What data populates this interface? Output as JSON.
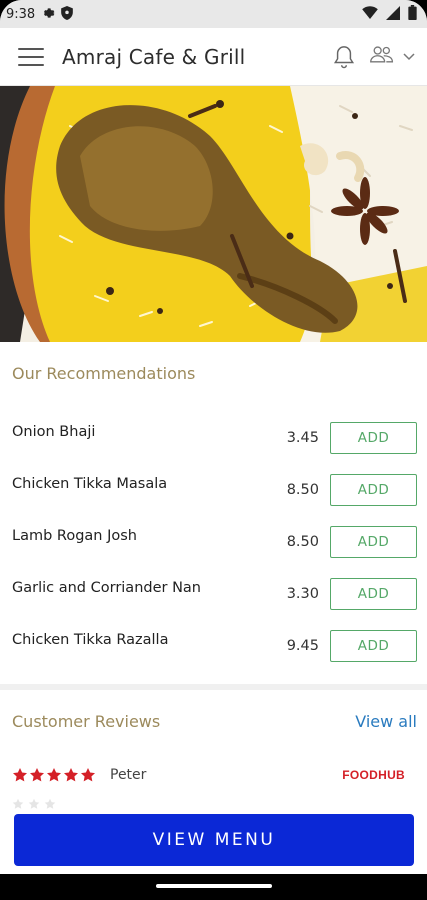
{
  "status_bar": {
    "time": "9:38",
    "icons": [
      "gear-icon",
      "shield-icon",
      "wifi-icon",
      "signal-icon",
      "battery-icon"
    ]
  },
  "app_bar": {
    "title": "Amraj Cafe & Grill",
    "icons": [
      "menu-icon",
      "bell-icon",
      "people-icon",
      "chevron-down-icon"
    ]
  },
  "hero": {
    "icon": "food-image"
  },
  "recommendations": {
    "title": "Our Recommendations",
    "items": [
      {
        "name": "Onion Bhaji",
        "price": "3.45",
        "button": "ADD"
      },
      {
        "name": "Chicken Tikka Masala",
        "price": "8.50",
        "button": "ADD"
      },
      {
        "name": "Lamb Rogan Josh",
        "price": "8.50",
        "button": "ADD"
      },
      {
        "name": "Garlic and Corriander Nan",
        "price": "3.30",
        "button": "ADD"
      },
      {
        "name": "Chicken Tikka Razalla",
        "price": "9.45",
        "button": "ADD"
      }
    ]
  },
  "reviews": {
    "title": "Customer Reviews",
    "view_all": "View all",
    "items": [
      {
        "rating": 5,
        "reviewer": "Peter",
        "source": "FOODHUB"
      }
    ]
  },
  "view_menu_label": "VIEW MENU",
  "colors": {
    "accent_green": "#55a868",
    "primary_blue": "#0b28d6",
    "section_title": "#9c8a5c",
    "link_blue": "#2a7bbf",
    "star_red": "#d42027"
  }
}
